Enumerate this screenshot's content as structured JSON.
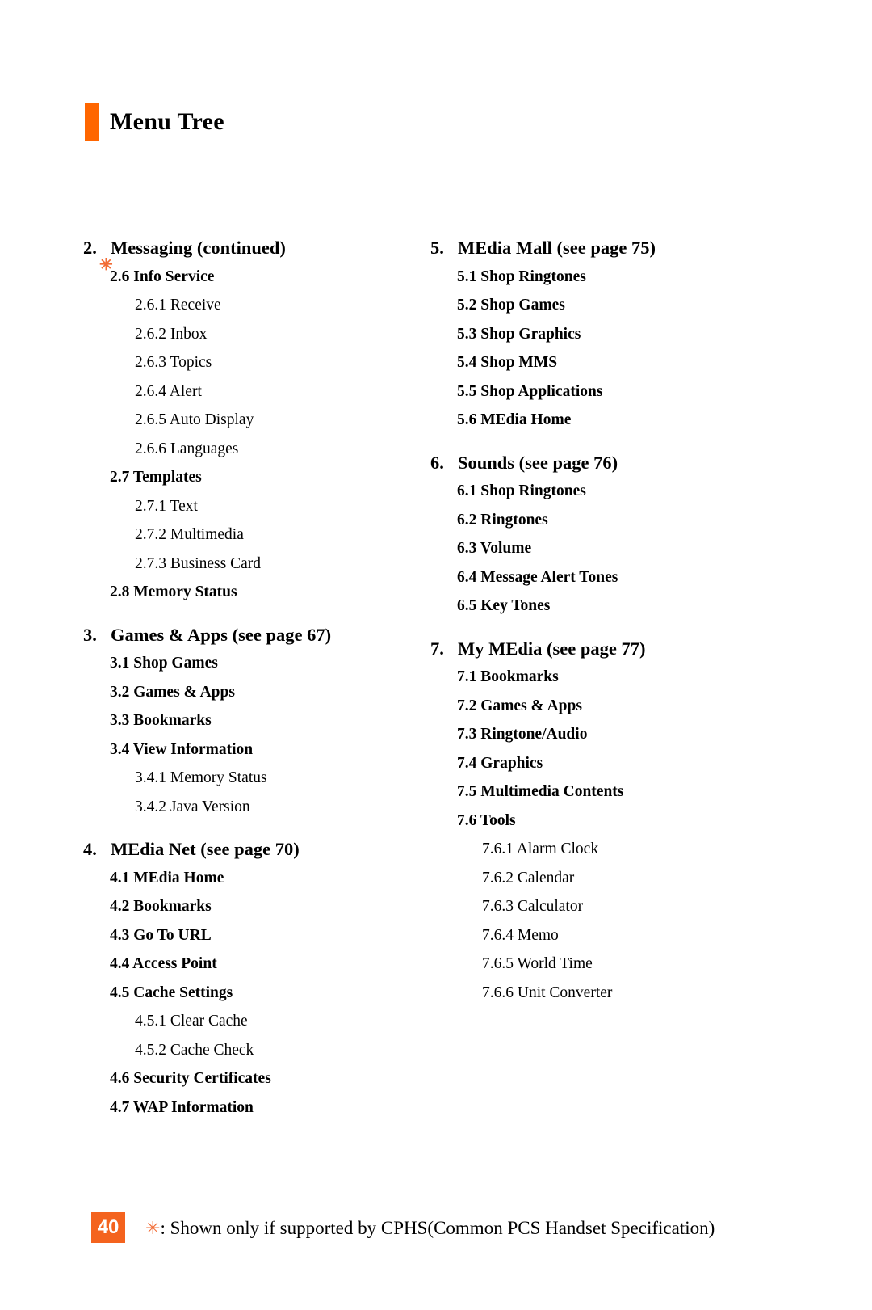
{
  "header": {
    "title": "Menu Tree",
    "accent_color": "#FF6600"
  },
  "footer": {
    "page_number": "40",
    "badge_color": "#F4631E",
    "footnote_marker": "✳",
    "footnote_text": ": Shown only if supported by CPHS(Common PCS Handset Specification)",
    "marker_color": "#F26B34"
  },
  "left_column": [
    {
      "number": "2.",
      "label": "Messaging (continued)",
      "items": [
        {
          "level": 2,
          "text": "2.6 Info Service",
          "marker": "✳"
        },
        {
          "level": 3,
          "text": "2.6.1 Receive"
        },
        {
          "level": 3,
          "text": "2.6.2 Inbox"
        },
        {
          "level": 3,
          "text": "2.6.3 Topics"
        },
        {
          "level": 3,
          "text": "2.6.4 Alert"
        },
        {
          "level": 3,
          "text": "2.6.5 Auto Display"
        },
        {
          "level": 3,
          "text": "2.6.6 Languages"
        },
        {
          "level": 2,
          "text": "2.7 Templates"
        },
        {
          "level": 3,
          "text": "2.7.1 Text"
        },
        {
          "level": 3,
          "text": "2.7.2 Multimedia"
        },
        {
          "level": 3,
          "text": "2.7.3 Business Card"
        },
        {
          "level": 2,
          "text": "2.8 Memory Status"
        }
      ]
    },
    {
      "number": "3.",
      "label": "Games & Apps (see page 67)",
      "items": [
        {
          "level": 2,
          "text": "3.1 Shop Games"
        },
        {
          "level": 2,
          "text": "3.2 Games & Apps"
        },
        {
          "level": 2,
          "text": "3.3 Bookmarks"
        },
        {
          "level": 2,
          "text": "3.4 View Information"
        },
        {
          "level": 3,
          "text": "3.4.1 Memory Status"
        },
        {
          "level": 3,
          "text": "3.4.2 Java Version"
        }
      ]
    },
    {
      "number": "4.",
      "label": "MEdia Net (see page 70)",
      "items": [
        {
          "level": 2,
          "text": "4.1 MEdia Home"
        },
        {
          "level": 2,
          "text": "4.2 Bookmarks"
        },
        {
          "level": 2,
          "text": "4.3 Go To URL"
        },
        {
          "level": 2,
          "text": "4.4 Access Point"
        },
        {
          "level": 2,
          "text": "4.5 Cache Settings"
        },
        {
          "level": 3,
          "text": "4.5.1 Clear Cache"
        },
        {
          "level": 3,
          "text": "4.5.2 Cache Check"
        },
        {
          "level": 2,
          "text": "4.6 Security Certificates"
        },
        {
          "level": 2,
          "text": "4.7 WAP Information"
        }
      ]
    }
  ],
  "right_column": [
    {
      "number": "5.",
      "label": "MEdia Mall (see page 75)",
      "items": [
        {
          "level": 2,
          "text": "5.1 Shop Ringtones"
        },
        {
          "level": 2,
          "text": "5.2 Shop Games"
        },
        {
          "level": 2,
          "text": "5.3 Shop Graphics"
        },
        {
          "level": 2,
          "text": "5.4 Shop MMS"
        },
        {
          "level": 2,
          "text": "5.5 Shop Applications"
        },
        {
          "level": 2,
          "text": "5.6 MEdia Home"
        }
      ]
    },
    {
      "number": "6.",
      "label": "Sounds (see page 76)",
      "items": [
        {
          "level": 2,
          "text": "6.1 Shop Ringtones"
        },
        {
          "level": 2,
          "text": "6.2 Ringtones"
        },
        {
          "level": 2,
          "text": "6.3 Volume"
        },
        {
          "level": 2,
          "text": "6.4 Message Alert Tones"
        },
        {
          "level": 2,
          "text": "6.5 Key Tones"
        }
      ]
    },
    {
      "number": "7.",
      "label": "My MEdia (see page 77)",
      "items": [
        {
          "level": 2,
          "text": "7.1 Bookmarks"
        },
        {
          "level": 2,
          "text": "7.2 Games & Apps"
        },
        {
          "level": 2,
          "text": "7.3 Ringtone/Audio"
        },
        {
          "level": 2,
          "text": "7.4 Graphics"
        },
        {
          "level": 2,
          "text": "7.5 Multimedia Contents"
        },
        {
          "level": 2,
          "text": "7.6 Tools"
        },
        {
          "level": 3,
          "text": "7.6.1 Alarm Clock"
        },
        {
          "level": 3,
          "text": "7.6.2 Calendar"
        },
        {
          "level": 3,
          "text": "7.6.3 Calculator"
        },
        {
          "level": 3,
          "text": "7.6.4 Memo"
        },
        {
          "level": 3,
          "text": "7.6.5 World Time"
        },
        {
          "level": 3,
          "text": "7.6.6 Unit Converter"
        }
      ]
    }
  ]
}
